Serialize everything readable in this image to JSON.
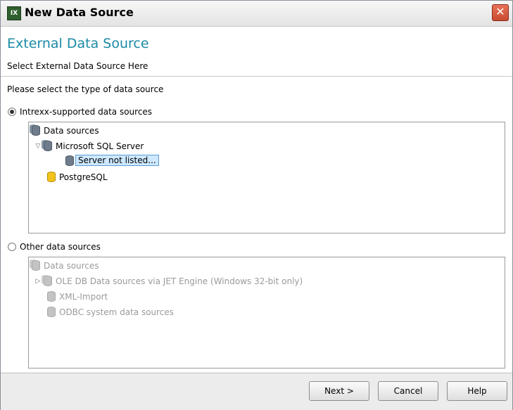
{
  "window": {
    "title": "New Data Source",
    "app_icon_text": "IX",
    "close_glyph": "✕"
  },
  "header": {
    "title": "External Data Source",
    "subtitle": "Select External Data Source Here"
  },
  "content": {
    "prompt": "Please select the type of data source",
    "supported": {
      "label": "Intrexx-supported data sources",
      "selected": true,
      "tree": {
        "root": "Data sources",
        "mssql": "Microsoft SQL Server",
        "server_not_listed": "Server not listed...",
        "postgres": "PostgreSQL"
      }
    },
    "other": {
      "label": "Other data sources",
      "selected": false,
      "tree": {
        "root": "Data sources",
        "oledb": "OLE DB Data sources via JET Engine (Windows 32-bit only)",
        "xml": "XML-Import",
        "odbc": "ODBC system data sources"
      }
    }
  },
  "buttons": {
    "next": "Next >",
    "cancel": "Cancel",
    "help": "Help"
  },
  "colors": {
    "header_title": "#1a8aa5",
    "selection_bg": "#cde8ff",
    "close_button": "#c84a2f"
  }
}
